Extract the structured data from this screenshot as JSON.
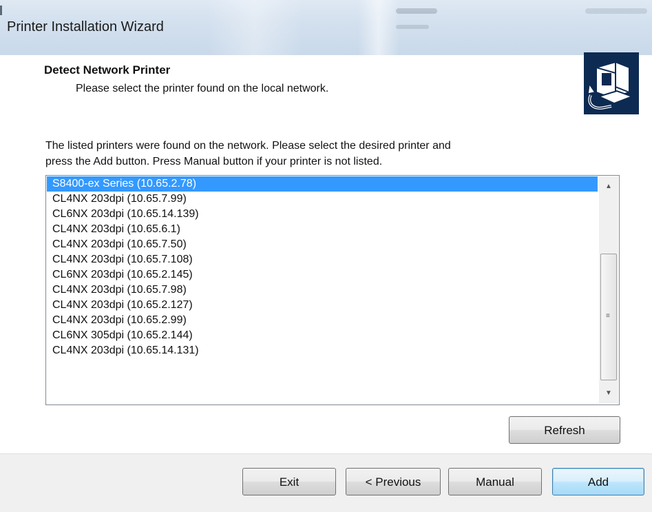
{
  "window": {
    "title": "Printer Installation Wizard"
  },
  "header": {
    "title": "Detect Network Printer",
    "subtitle": "Please select the printer found on the local network.",
    "icon": "printer-wizard-icon"
  },
  "description": {
    "line1": "The listed printers were found on the network. Please select the desired printer and",
    "line2": "press the Add button. Press Manual button if your printer is not listed."
  },
  "printer_list": {
    "selected_index": 0,
    "items": [
      "S8400-ex  Series (10.65.2.78)",
      "CL4NX 203dpi (10.65.7.99)",
      "CL6NX 203dpi (10.65.14.139)",
      "CL4NX 203dpi (10.65.6.1)",
      "CL4NX 203dpi (10.65.7.50)",
      "CL4NX 203dpi (10.65.7.108)",
      "CL6NX 203dpi (10.65.2.145)",
      "CL4NX 203dpi (10.65.7.98)",
      "CL4NX 203dpi (10.65.2.127)",
      "CL4NX 203dpi (10.65.2.99)",
      "CL6NX 305dpi (10.65.2.144)",
      "CL4NX 203dpi (10.65.14.131)"
    ]
  },
  "buttons": {
    "refresh": "Refresh",
    "exit": "Exit",
    "previous": "< Previous",
    "manual": "Manual",
    "add": "Add"
  },
  "colors": {
    "selection": "#3399ff",
    "default_button_border": "#3c7fb1"
  }
}
